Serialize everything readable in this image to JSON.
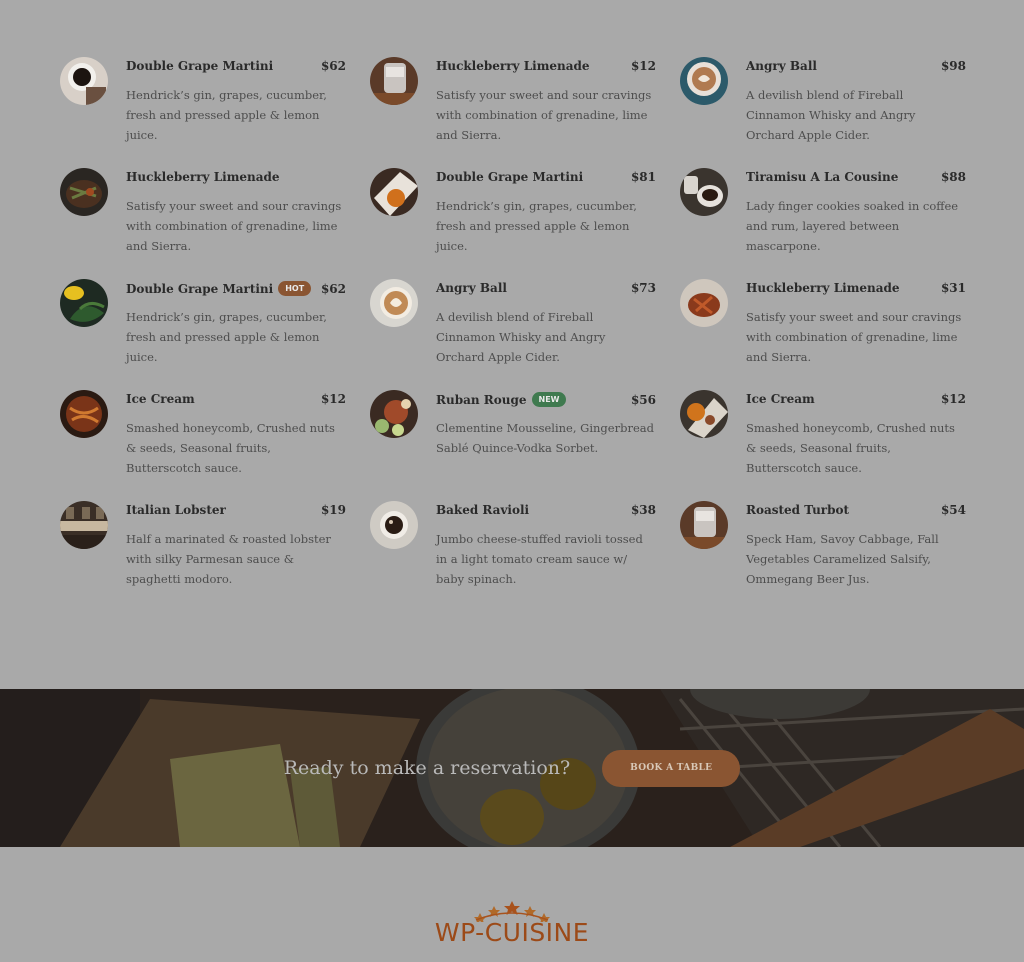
{
  "menu": {
    "items": [
      {
        "name": "Double Grape Martini",
        "price": "$62",
        "badge": "",
        "desc": "Hendrick’s gin, grapes, cucumber, fresh and pressed apple & lemon juice.",
        "image_icon": "coffee-cup-photo"
      },
      {
        "name": "Huckleberry Limenade",
        "price": "$12",
        "badge": "",
        "desc": "Satisfy your sweet and sour cravings with combination of grenadine, lime and Sierra.",
        "image_icon": "drink-glass-photo"
      },
      {
        "name": "Angry Ball",
        "price": "$98",
        "badge": "",
        "desc": "A devilish blend of Fireball Cinnamon Whisky and Angry Orchard Apple Cider.",
        "image_icon": "latte-photo"
      },
      {
        "name": "Huckleberry Limenade",
        "price": "",
        "badge": "",
        "desc": "Satisfy your sweet and sour cravings with combination of grenadine, lime and Sierra.",
        "image_icon": "grilled-dish-photo"
      },
      {
        "name": "Double Grape Martini",
        "price": "$81",
        "badge": "",
        "desc": "Hendrick’s gin, grapes, cucumber, fresh and pressed apple & lemon juice.",
        "image_icon": "orange-plate-photo"
      },
      {
        "name": "Tiramisu A La Cousine",
        "price": "$88",
        "badge": "",
        "desc": "Lady finger cookies soaked in coffee and rum, layered between mascarpone.",
        "image_icon": "espresso-cups-photo"
      },
      {
        "name": "Double Grape Martini",
        "price": "$62",
        "badge": "HOT",
        "desc": "Hendrick’s gin, grapes, cucumber, fresh and pressed apple & lemon juice.",
        "image_icon": "lemon-greens-photo"
      },
      {
        "name": "Angry Ball",
        "price": "$73",
        "badge": "",
        "desc": "A devilish blend of Fireball Cinnamon Whisky and Angry Orchard Apple Cider.",
        "image_icon": "latte-art-photo"
      },
      {
        "name": "Huckleberry Limenade",
        "price": "$31",
        "badge": "",
        "desc": "Satisfy your sweet and sour cravings with combination of grenadine, lime and Sierra.",
        "image_icon": "roast-dish-photo"
      },
      {
        "name": "Ice Cream",
        "price": "$12",
        "badge": "",
        "desc": "Smashed honeycomb, Crushed nuts & seeds, Seasonal fruits, Butterscotch sauce.",
        "image_icon": "dessert-photo"
      },
      {
        "name": "Ruban Rouge",
        "price": "$56",
        "badge": "NEW",
        "desc": "Clementine Mousseline, Gingerbread Sablé Quince-Vodka Sorbet.",
        "image_icon": "salad-photo"
      },
      {
        "name": "Ice Cream",
        "price": "$12",
        "badge": "",
        "desc": "Smashed honeycomb, Crushed nuts & seeds, Seasonal fruits, Butterscotch sauce.",
        "image_icon": "fruit-plate-photo"
      },
      {
        "name": "Italian Lobster",
        "price": "$19",
        "badge": "",
        "desc": "Half a marinated & roasted lobster with silky Parmesan sauce & spaghetti modoro.",
        "image_icon": "restaurant-interior-photo"
      },
      {
        "name": "Baked Ravioli",
        "price": "$38",
        "badge": "",
        "desc": "Jumbo cheese-stuffed ravioli tossed in a light tomato cream sauce w/ baby spinach.",
        "image_icon": "coffee-top-photo"
      },
      {
        "name": "Roasted Turbot",
        "price": "$54",
        "badge": "",
        "desc": "Speck Ham, Savoy Cabbage, Fall Vegetables Caramelized Salsify, Ommegang Beer Jus.",
        "image_icon": "drink-glass-photo"
      }
    ]
  },
  "reservation": {
    "text": "Ready to make a reservation?",
    "button_label": "BOOK A TABLE"
  },
  "footer": {
    "logo_text": "WP-CUISINE",
    "logo_icon": "stars-logo-icon"
  },
  "colors": {
    "hot_badge": "#8a5532",
    "new_badge": "#3f7a4f",
    "brand": "#9c4a18"
  }
}
